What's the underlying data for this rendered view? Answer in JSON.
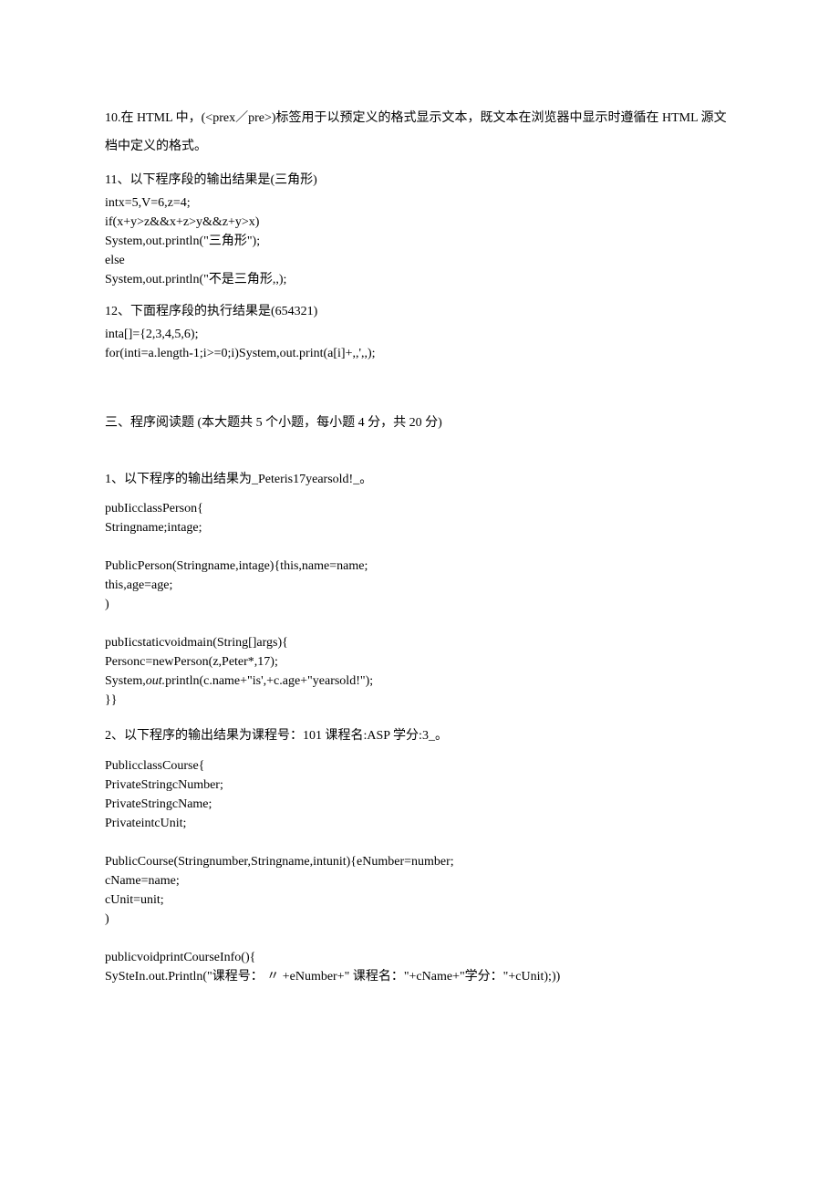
{
  "q10": {
    "text": "10.在 HTML 中，(<prex／pre>)标签用于以预定义的格式显示文本，既文本在浏览器中显示时遵循在 HTML 源文档中定义的格式。"
  },
  "q11": {
    "head": "11、以下程序段的输出结果是(三角形)",
    "code": [
      "intx=5,V=6,z=4;",
      "if(x+y>z&&x+z>y&&z+y>x)",
      "System,out.println(\"三角形\");",
      "else",
      "System,out.println(\"不是三角形,,);"
    ]
  },
  "q12": {
    "head": "12、下面程序段的执行结果是(654321)",
    "code": [
      "inta[]={2,3,4,5,6);",
      "for(inti=a.length-1;i>=0;i)System,out.print(a[i]+,,',,);"
    ]
  },
  "section3": {
    "title": "三、程序阅读题 (本大题共 5 个小题，每小题 4 分，共 20 分)"
  },
  "p1": {
    "head": "1、以下程序的输出结果为_Peteris17yearsold!_。",
    "code": [
      "pubIicclassPerson{",
      "Stringname;intage;",
      "",
      "PublicPerson(Stringname,intage){this,name=name;",
      "this,age=age;",
      ")",
      "",
      "pubIicstaticvoidmain(String[]args){",
      "Personc=newPerson(z,Peter*,17);",
      "System,out.println(c.name+\"is',+c.age+\"yearsold!\");",
      "}}"
    ],
    "italic_index": 9
  },
  "p2": {
    "head": "2、以下程序的输出结果为课程号：101 课程名:ASP 学分:3_。",
    "code": [
      "PublicclassCourse{",
      "PrivateStringcNumber;",
      "PrivateStringcName;",
      "PrivateintcUnit;",
      "",
      "PublicCourse(Stringnumber,Stringname,intunit){eNumber=number;",
      "cName=name;",
      "cUnit=unit;",
      ")",
      "",
      "publicvoidprintCourseInfo(){",
      "SySteIn.out.Println(\"课程号： 〃 +eNumber+\" 课程名：\"+cName+\"学分：\"+cUnit);))"
    ]
  }
}
